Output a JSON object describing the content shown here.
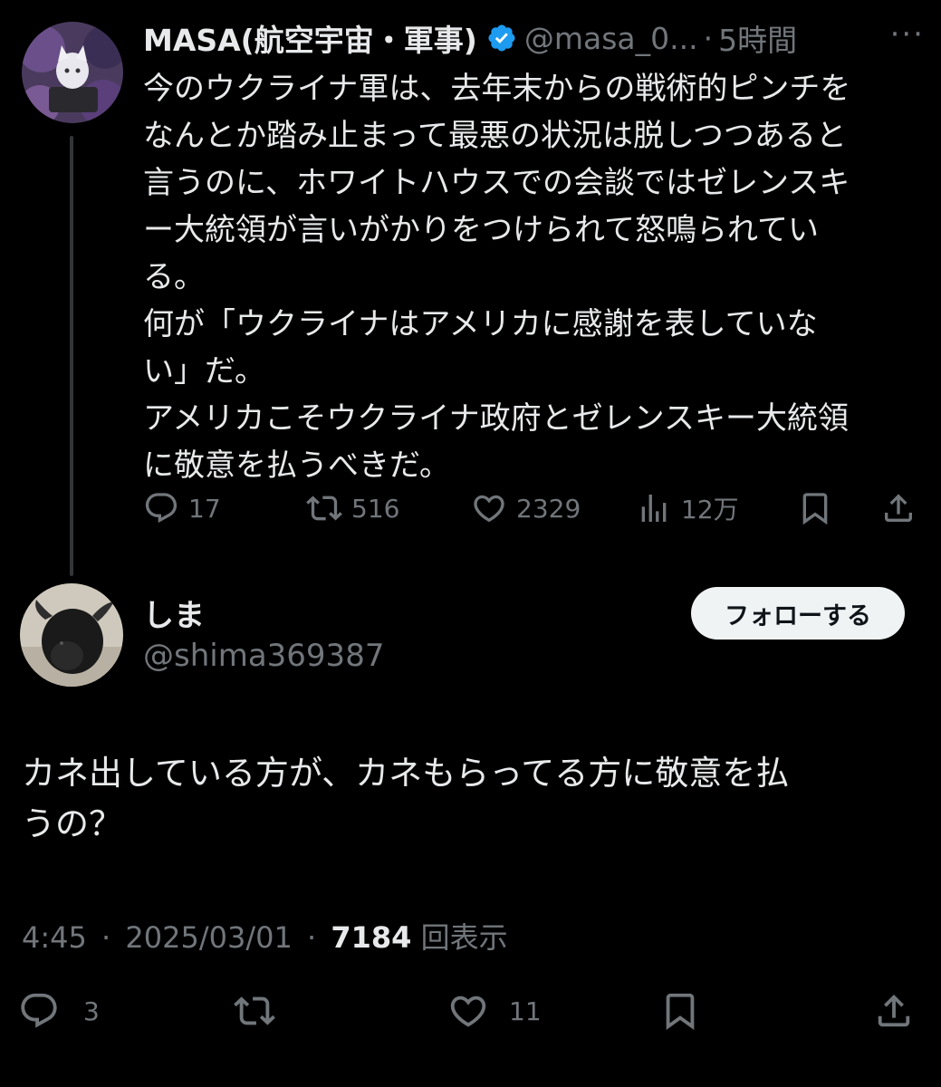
{
  "colors": {
    "background": "#000000",
    "text_primary": "#e7e9ea",
    "text_secondary": "#71767b",
    "verified_blue": "#1d9bf0",
    "follow_button_bg": "#eff3f4"
  },
  "original_post": {
    "display_name": "MASA(航空宇宙・軍事)",
    "handle": "@masa_0...",
    "separator": "·",
    "time_ago": "5時間",
    "more_glyph": "···",
    "verified_icon": "verified-badge-icon",
    "text": "今のウクライナ軍は、去年末からの戦術的ピンチを\nなんとか踏み止まって最悪の状況は脱しつつあると\n言うのに、ホワイトハウスでの会談ではゼレンスキ\nー大統領が言いがかりをつけられて怒鳴られてい\nる。\n何が「ウクライナはアメリカに感謝を表していな\nい」だ。\nアメリカこそウクライナ政府とゼレンスキー大統領\nに敬意を払うべきだ。",
    "actions": {
      "replies": "17",
      "reposts": "516",
      "likes": "2329",
      "views": "12万"
    }
  },
  "reply_post": {
    "display_name": "しま",
    "handle": "@shima369387",
    "follow_label": "フォローする",
    "text": "カネ出している方が、カネもらってる方に敬意を払\nうの？",
    "time": "4:45",
    "separator1": "·",
    "date": "2025/03/01",
    "separator2": "·",
    "view_count": "7184",
    "view_label": "回表示",
    "actions": {
      "replies": "3",
      "likes": "11"
    }
  }
}
